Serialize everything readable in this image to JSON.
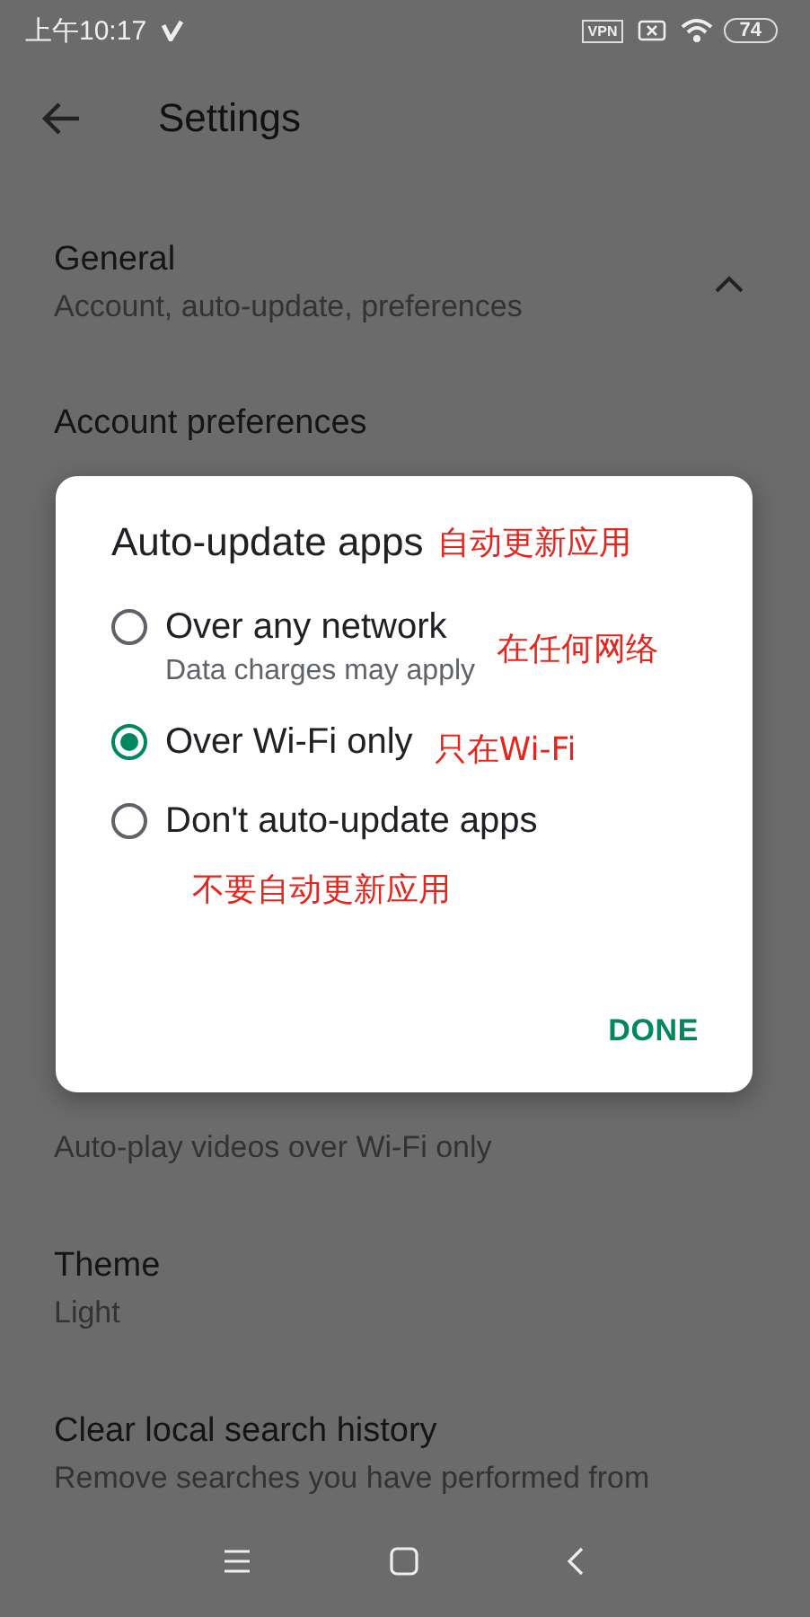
{
  "status_bar": {
    "time": "上午10:17",
    "vpn": "VPN",
    "battery": "74"
  },
  "app_bar": {
    "title": "Settings"
  },
  "section": {
    "title": "General",
    "subtitle": "Account, auto-update, preferences",
    "expanded": true
  },
  "items": [
    {
      "title": "Account preferences"
    },
    {
      "subtitle": "Auto-play videos over Wi-Fi only"
    },
    {
      "title": "Theme",
      "subtitle": "Light"
    },
    {
      "title": "Clear local search history",
      "subtitle": "Remove searches you have performed from"
    }
  ],
  "dialog": {
    "title": "Auto-update apps",
    "title_note": "自动更新应用",
    "options": [
      {
        "label": "Over any network",
        "sublabel": "Data charges may apply",
        "selected": false,
        "note": "在任何网络"
      },
      {
        "label": "Over Wi-Fi only",
        "selected": true,
        "note": "只在Wi-Fi"
      },
      {
        "label": "Don't auto-update apps",
        "selected": false,
        "note": "不要自动更新应用"
      }
    ],
    "button": "DONE"
  }
}
